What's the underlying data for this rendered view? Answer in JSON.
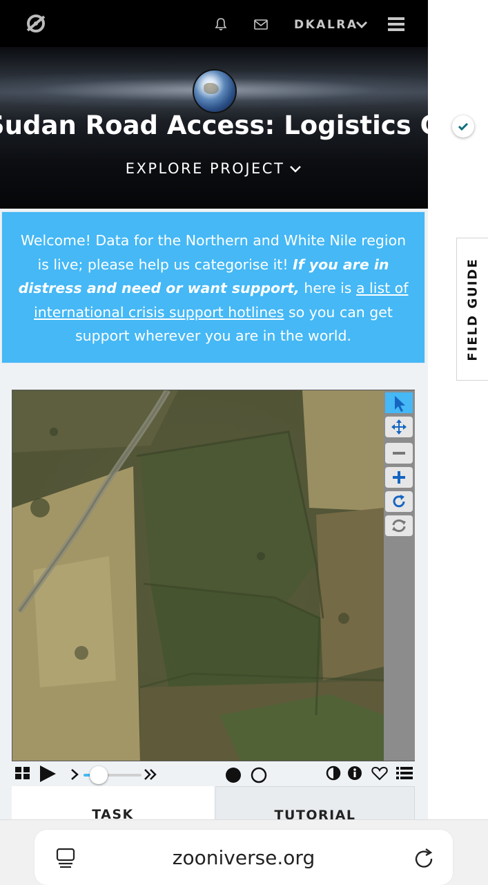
{
  "nav": {
    "username": "DKALRA",
    "icons": [
      "zooniverse-logo-icon",
      "bell-icon",
      "mail-icon",
      "chevron-down-icon",
      "hamburger-menu-icon"
    ]
  },
  "hero": {
    "title": "Sudan Road Access: Logistics Cluster",
    "explore_label": "EXPLORE PROJECT"
  },
  "banner": {
    "text_1": "Welcome! Data for the Northern and White Nile region is live; please help us categorise it! ",
    "emphasis": "If you are in distress and need or want support,",
    "text_2": " here is ",
    "link": "a list of international crisis support hotlines",
    "text_3": " so you can get support wherever you are in the world."
  },
  "viewer": {
    "tools": [
      "pointer-icon",
      "pan-icon",
      "zoom-out-icon",
      "zoom-in-icon",
      "rotate-icon",
      "reset-icon"
    ],
    "controls": [
      "grid-icon",
      "play-icon",
      "chevron-right-icon",
      "speed-slider",
      "fast-forward-icon",
      "dot-filled-icon",
      "dot-empty-icon",
      "contrast-icon",
      "info-icon",
      "heart-icon",
      "list-icon"
    ],
    "slider_level": 0.1
  },
  "tabs": {
    "task": "TASK",
    "tutorial": "TUTORIAL"
  },
  "sidebar": {
    "field_guide": "FIELD GUIDE"
  },
  "browser": {
    "url": "zooniverse.org"
  },
  "colors": {
    "accent": "#45b8f5",
    "nav_bg": "#000000",
    "page_bg": "#eff2f5"
  }
}
